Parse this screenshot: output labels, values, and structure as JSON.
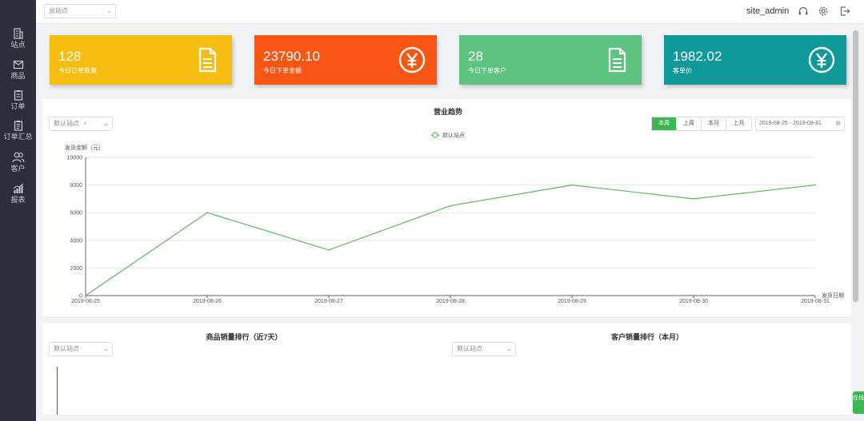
{
  "header": {
    "site_select": "总站点",
    "username": "site_admin"
  },
  "sidebar": {
    "items": [
      {
        "label": "站点",
        "icon": "building-icon"
      },
      {
        "label": "商品",
        "icon": "box-icon"
      },
      {
        "label": "订单",
        "icon": "clipboard-icon"
      },
      {
        "label": "订单汇总",
        "icon": "clipboard-list-icon"
      },
      {
        "label": "客户",
        "icon": "users-icon"
      },
      {
        "label": "报表",
        "icon": "bar-chart-icon"
      }
    ]
  },
  "cards": [
    {
      "value": "128",
      "label": "今日订单数量",
      "color": "#f5bd0f",
      "icon": "document-icon"
    },
    {
      "value": "23790.10",
      "label": "今日下单金额",
      "color": "#fa5613",
      "icon": "yen-icon"
    },
    {
      "value": "28",
      "label": "今日下单客户",
      "color": "#5cc47e",
      "icon": "document-icon"
    },
    {
      "value": "1982.02",
      "label": "客单价",
      "color": "#109999",
      "icon": "yen-icon"
    }
  ],
  "trend": {
    "title": "营业趋势",
    "site_select": "默认站点",
    "tabs": [
      "本周",
      "上周",
      "本月",
      "上月"
    ],
    "active_tab": 0,
    "date_range": "2019-08-25 - 2019-08-31"
  },
  "chart_data": {
    "type": "line",
    "title": "营业趋势",
    "ylabel": "发货金额（元）",
    "xlabel": "发货日期",
    "x": [
      "2019-08-25",
      "2019-08-26",
      "2019-08-27",
      "2019-08-28",
      "2019-08-29",
      "2019-08-30",
      "2019-08-31"
    ],
    "yticks": [
      0,
      2000,
      4000,
      6000,
      8000,
      10000
    ],
    "ylim": [
      0,
      10000
    ],
    "grid": true,
    "legend": "top-center",
    "series": [
      {
        "name": "默认站点",
        "color": "#5cb85c",
        "values": [
          0,
          6000,
          3300,
          6500,
          8000,
          7000,
          8000
        ]
      }
    ]
  },
  "bottom": {
    "left_title": "商品销量排行（近7天）",
    "left_select": "默认站点",
    "right_title": "客户销量排行（本月）",
    "right_select": "默认站点"
  },
  "float_button": "在线"
}
